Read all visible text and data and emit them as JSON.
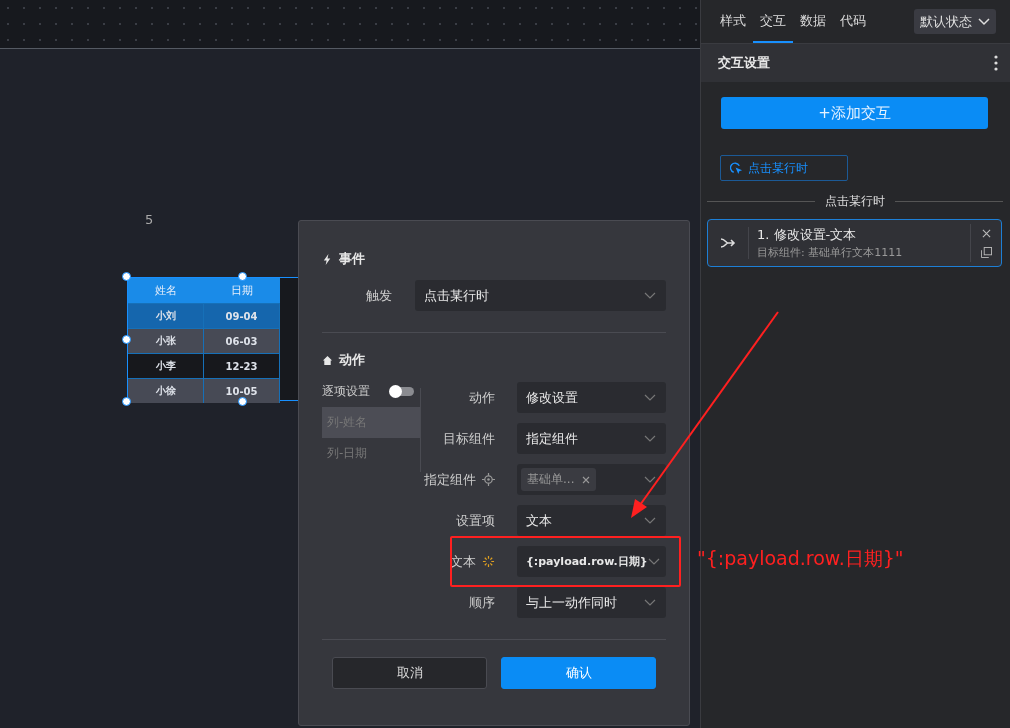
{
  "canvas": {
    "marker": "5",
    "table": {
      "columns": [
        "姓名",
        "日期"
      ],
      "rows": [
        {
          "cells": [
            "小刘",
            "09-04"
          ],
          "selected": true
        },
        {
          "cells": [
            "小张",
            "06-03"
          ],
          "selected": false
        },
        {
          "cells": [
            "小李",
            "12-23"
          ],
          "selected": false
        },
        {
          "cells": [
            "小徐",
            "10-05"
          ],
          "selected": false
        }
      ]
    }
  },
  "dialog": {
    "event_section": {
      "title": "事件",
      "fields": [
        {
          "label": "触发",
          "value": "点击某行时"
        }
      ]
    },
    "action_section": {
      "title": "动作",
      "toggle": {
        "label": "逐项设置",
        "on": false
      },
      "list": [
        {
          "label": "列-姓名",
          "selected": true
        },
        {
          "label": "列-日期",
          "selected": false
        }
      ],
      "fields": [
        {
          "kind": "select",
          "label": "动作",
          "value": "修改设置",
          "highlighted": false
        },
        {
          "kind": "select",
          "label": "目标组件",
          "value": "指定组件",
          "highlighted": false
        },
        {
          "kind": "target",
          "label": "指定组件",
          "tag": "基础单...",
          "highlighted": false
        },
        {
          "kind": "select",
          "label": "设置项",
          "value": "文本",
          "highlighted": false
        },
        {
          "kind": "dynamic",
          "label": "文本",
          "value": "{:payload.row.日期}",
          "highlighted": true
        },
        {
          "kind": "select",
          "label": "顺序",
          "value": "与上一动作同时",
          "highlighted": false
        }
      ]
    },
    "buttons": [
      {
        "label": "取消",
        "kind": "secondary"
      },
      {
        "label": "确认",
        "kind": "primary"
      }
    ]
  },
  "panel": {
    "tabs": [
      {
        "label": "样式",
        "selected": false
      },
      {
        "label": "交互",
        "selected": true
      },
      {
        "label": "数据",
        "selected": false
      },
      {
        "label": "代码",
        "selected": false
      }
    ],
    "state_dropdown": "默认状态",
    "header": "交互设置",
    "add_button": "+添加交互",
    "trigger_tag": "点击某行时",
    "group_title": "点击某行时",
    "actions": [
      {
        "title": "1. 修改设置-文本",
        "subtitle": "目标组件: 基础单行文本1111"
      }
    ]
  },
  "annotation": {
    "text": "\"{:payload.row.日期}\""
  }
}
